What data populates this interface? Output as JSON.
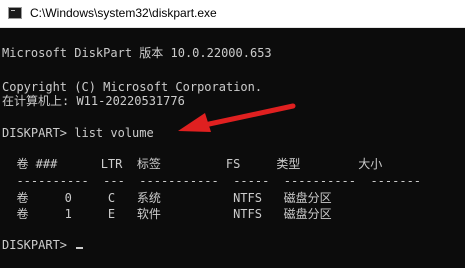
{
  "window": {
    "title": "C:\\Windows\\system32\\diskpart.exe",
    "app_icon": "console-icon"
  },
  "console": {
    "banner": "Microsoft DiskPart 版本 10.0.22000.653",
    "copyright": "Copyright (C) Microsoft Corporation.",
    "computer": "在计算机上: W11-20220531776",
    "command_prompt": "DISKPART> list volume",
    "table_header": "  卷 ###      LTR  标签         FS     类型        大小",
    "table_divider": "  ----------  ---  -----------  -----  ----------  -------",
    "rows": [
      "  卷     0     C   系统          NTFS   磁盘分区",
      "  卷     1     E   软件          NTFS   磁盘分区"
    ],
    "prompt": "DISKPART> "
  },
  "annotation": {
    "arrow_color": "#e02020"
  }
}
